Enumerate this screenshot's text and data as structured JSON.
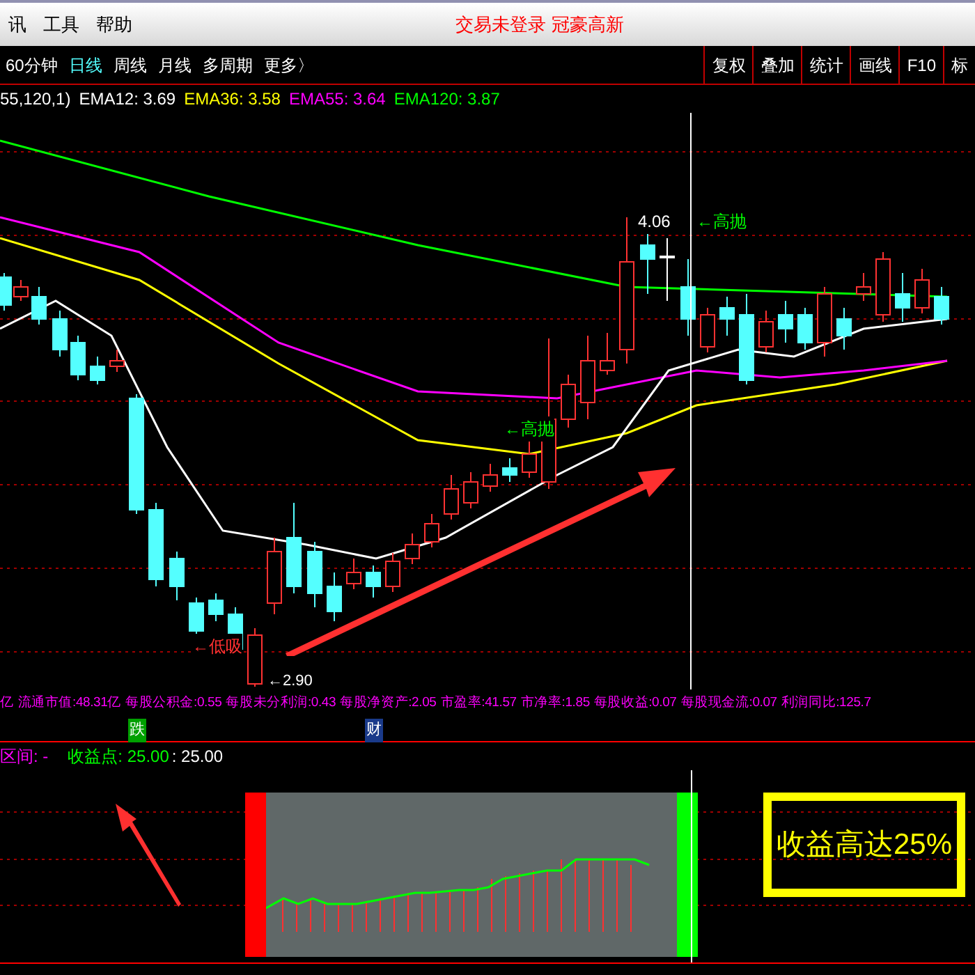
{
  "menu": {
    "items": [
      "讯",
      "工具",
      "帮助"
    ],
    "status": "交易未登录",
    "stock": "冠豪高新"
  },
  "periods": [
    {
      "label": "60分钟",
      "selected": false
    },
    {
      "label": "日线",
      "selected": true
    },
    {
      "label": "周线",
      "selected": false
    },
    {
      "label": "月线",
      "selected": false
    },
    {
      "label": "多周期",
      "selected": false
    },
    {
      "label": "更多〉",
      "selected": false
    }
  ],
  "tools": [
    "复权",
    "叠加",
    "统计",
    "画线",
    "F10",
    "标"
  ],
  "indicators": [
    {
      "text": "55,120,1)",
      "color": "#ffffff"
    },
    {
      "text": "EMA12: 3.69",
      "color": "#ffffff"
    },
    {
      "text": "EMA36: 3.58",
      "color": "#ffff00"
    },
    {
      "text": "EMA55: 3.64",
      "color": "#ff00ff"
    },
    {
      "text": "EMA120: 3.87",
      "color": "#00ff00"
    }
  ],
  "annotations": {
    "high_price": "4.06",
    "high_tag": "←高抛",
    "mid_tag": "←高抛",
    "low_tag": "←低吸",
    "low_price": "←2.90"
  },
  "fundamentals": [
    "亿",
    "流通市值:48.31亿",
    "每股公积金:0.55",
    "每股未分利润:0.43",
    "每股净资产:2.05",
    "市盈率:41.57",
    "市净率:1.85",
    "每股收益:0.07",
    "每股现金流:0.07",
    "利润同比:125.7"
  ],
  "markers": [
    {
      "text": "跌",
      "color": "#00a000"
    },
    {
      "text": "财",
      "color": "#1a3a8a"
    }
  ],
  "sub_indicator": {
    "range": "区间: -",
    "profit": "收益点: 25.00",
    "value": ": 25.00"
  },
  "promo": "收益高达25%"
}
